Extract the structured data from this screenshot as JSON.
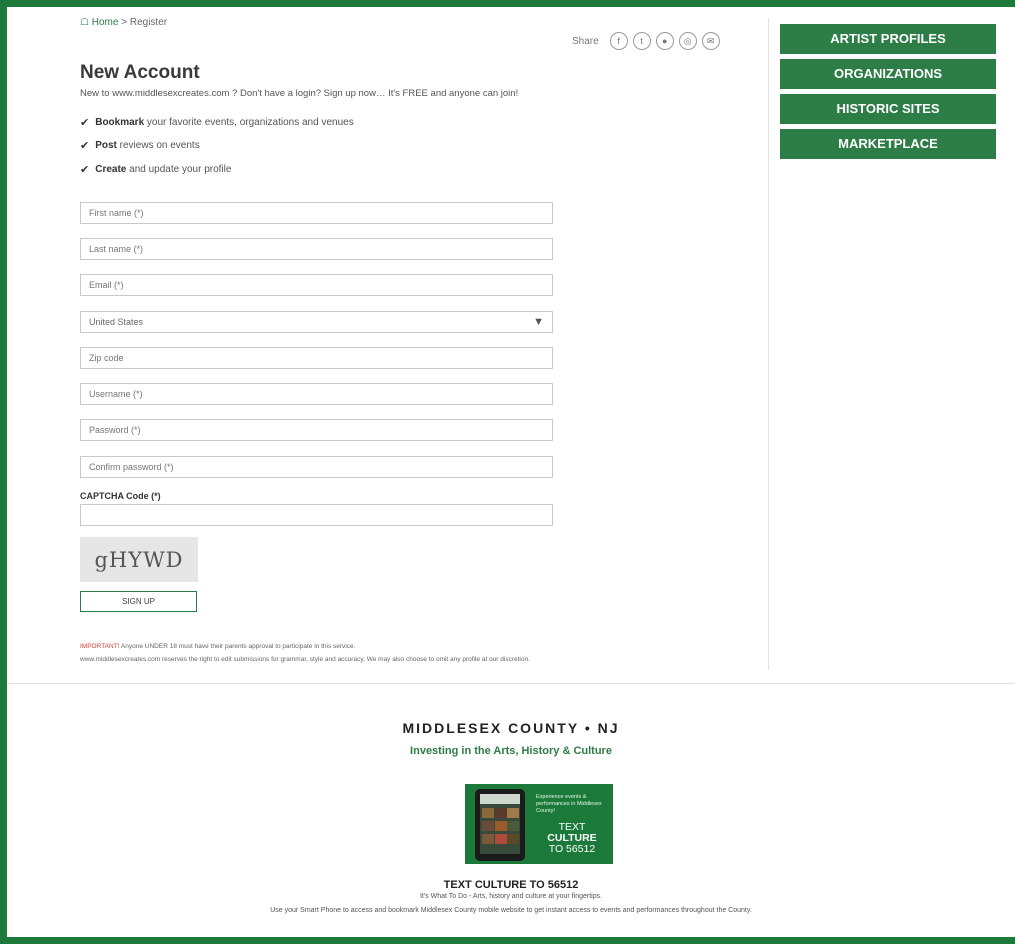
{
  "breadcrumb": {
    "home": "Home",
    "separator": ">",
    "current": "Register"
  },
  "share": {
    "label": "Share",
    "icons": [
      "facebook-icon",
      "twitter-icon",
      "pinterest-icon",
      "instagram-icon",
      "email-icon"
    ]
  },
  "page": {
    "title": "New Account",
    "intro": "New to www.middlesexcreates.com ? Don't have a login? Sign up now… It's FREE and anyone can join!"
  },
  "benefits": [
    {
      "bold": "Bookmark",
      "text": " your favorite events, organizations and venues"
    },
    {
      "bold": "Post",
      "text": " reviews on events"
    },
    {
      "bold": "Create",
      "text": " and update your profile"
    }
  ],
  "form": {
    "first_name": {
      "placeholder": "First name (*)",
      "value": ""
    },
    "last_name": {
      "placeholder": "Last name (*)",
      "value": ""
    },
    "email": {
      "placeholder": "Email (*)",
      "value": ""
    },
    "country": {
      "value": "United States"
    },
    "zip": {
      "placeholder": "Zip code",
      "value": ""
    },
    "username": {
      "placeholder": "Username (*)",
      "value": ""
    },
    "password": {
      "placeholder": "Password (*)",
      "value": ""
    },
    "confirm_password": {
      "placeholder": "Confirm password (*)",
      "value": ""
    },
    "captcha_label": "CAPTCHA Code (*)",
    "captcha_value": "",
    "captcha_text": "gHYWD",
    "signup_label": "SIGN UP"
  },
  "notes": {
    "important": "IMPORTANT!",
    "under18": " Anyone UNDER 18 must have their parents approval to participate in this service.",
    "rights": "www.middlesexcreates.com reserves the right to edit submissions for grammar, style and accuracy. We may also choose to omit any profile at our discretion."
  },
  "sidebar": {
    "items": [
      {
        "label": "ARTIST PROFILES"
      },
      {
        "label": "ORGANIZATIONS"
      },
      {
        "label": "HISTORIC SITES"
      },
      {
        "label": "MARKETPLACE"
      }
    ]
  },
  "footer": {
    "title": "MIDDLESEX COUNTY • NJ",
    "tagline": "Investing in the Arts, History & Culture",
    "promo": {
      "small": "Experience events & performances in Middlesex County!",
      "big1": "TEXT",
      "big2": "CULTURE",
      "big3": "TO 56512"
    },
    "text_culture": "TEXT CULTURE TO 56512",
    "sub1": "It's What To Do - Arts, history and culture at your fingertips.",
    "sub2": "Use your Smart Phone to access and bookmark Middlesex County mobile website to get instant access to events and performances throughout the County."
  },
  "colors": {
    "brand_green": "#2d7d46",
    "frame_green": "#1e7a3a",
    "important_red": "#e53935"
  }
}
